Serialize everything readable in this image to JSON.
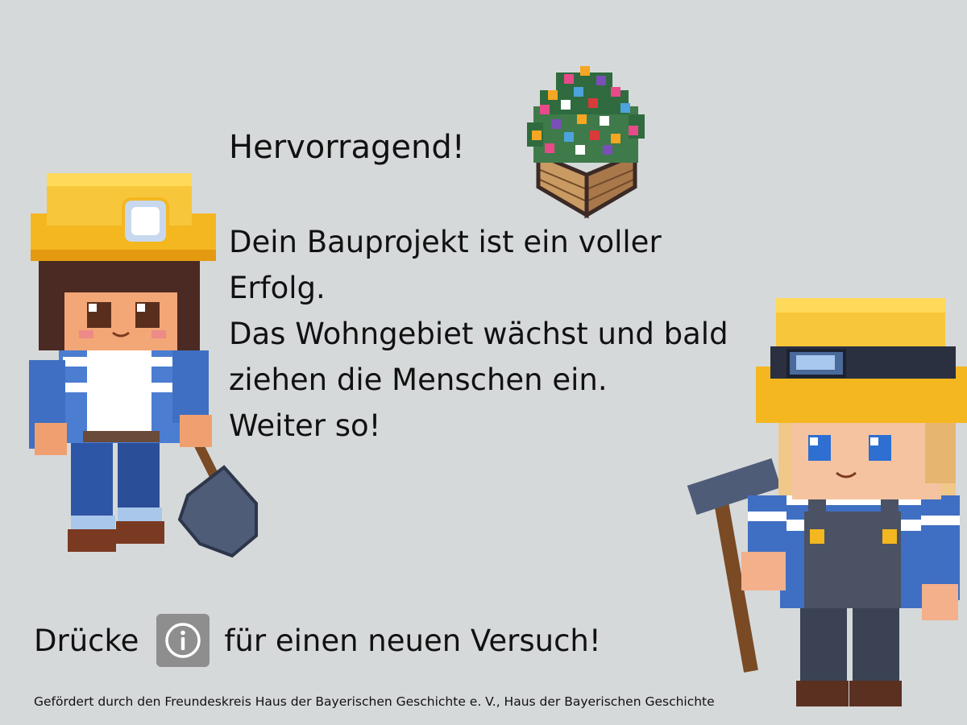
{
  "heading": "Hervorragend!",
  "message_lines": [
    "Dein Bauprojekt ist ein voller",
    "Erfolg.",
    "Das Wohngebiet wächst und bald",
    "ziehen die Menschen ein.",
    "Weiter so!"
  ],
  "retry": {
    "before": "Drücke",
    "icon": "info-icon",
    "after": "für einen neuen Versuch!"
  },
  "footer": "Gefördert durch den Freundeskreis Haus der Bayerischen Geschichte e. V., Haus der Bayerischen Geschichte",
  "colors": {
    "background": "#d6d9da",
    "button": "#8e8e8e",
    "helmet": "#f4b71f"
  }
}
